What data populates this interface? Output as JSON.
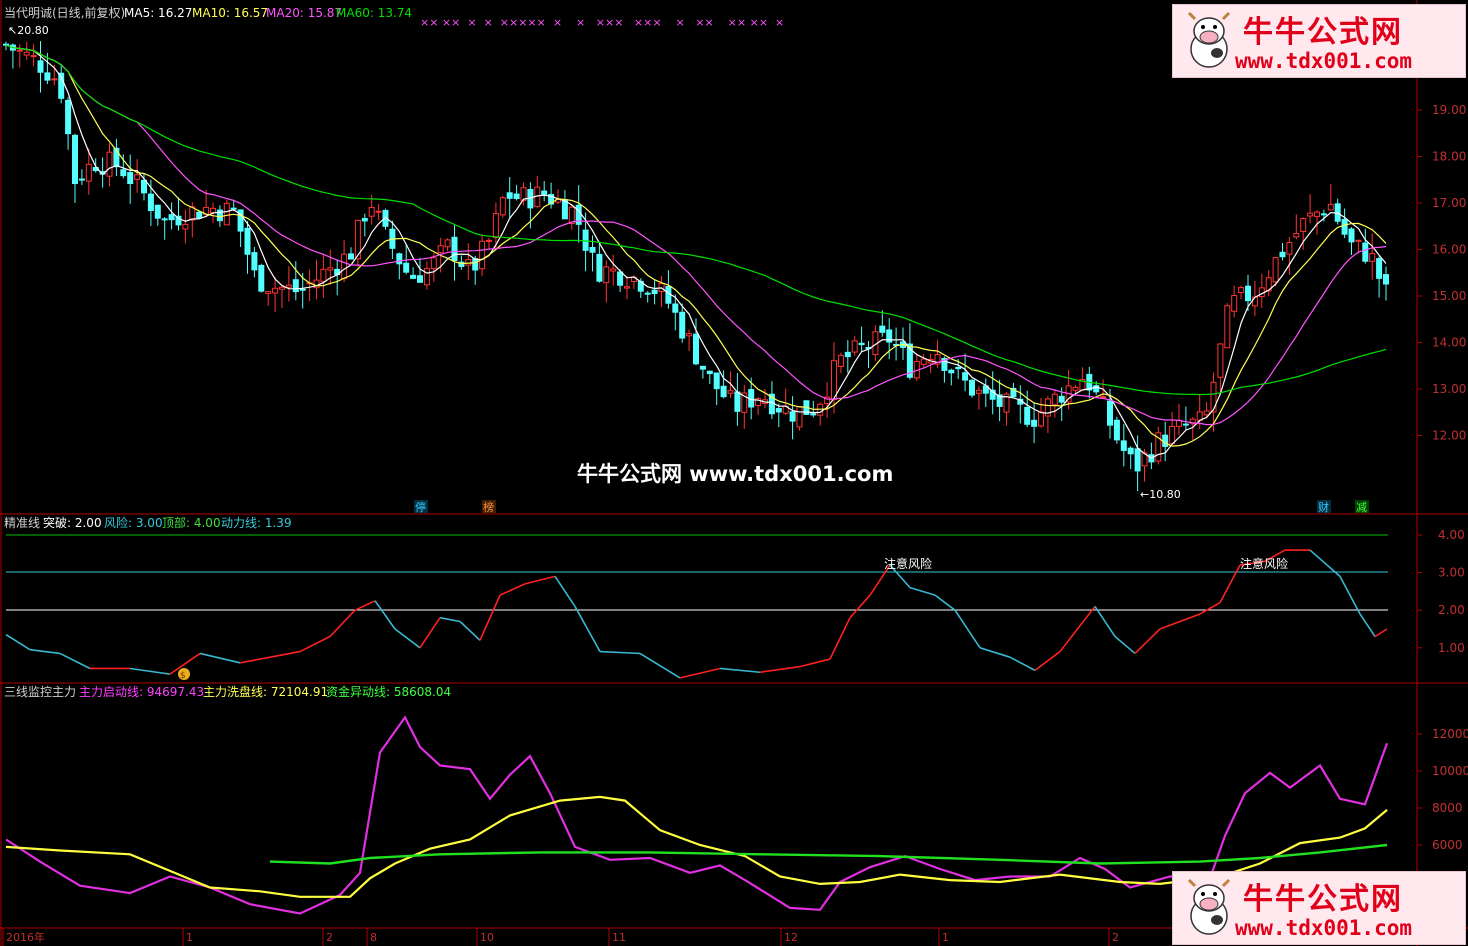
{
  "header": {
    "stock_label": "当代明诚(日线,前复权)",
    "ma5": "MA5: 16.27",
    "ma10": "MA10: 16.57",
    "ma20": "MA20: 15.87",
    "ma60": "MA60: 13.74"
  },
  "price_panel": {
    "high_label": "20.80",
    "low_label": "10.80",
    "yticks": [
      "19.00",
      "18.00",
      "17.00",
      "16.00",
      "15.00",
      "14.00",
      "13.00",
      "12.00"
    ],
    "badges": [
      {
        "text": "停",
        "color": "#38c8ff"
      },
      {
        "text": "榜",
        "color": "#ff9040"
      },
      {
        "text": "财",
        "color": "#38c8ff"
      },
      {
        "text": "减",
        "color": "#40ff40"
      }
    ],
    "cross_marks": "×× ××  ×  ×  ×××××  ×    ×   ×××   ×××    ×   ××    ×× ××  ×"
  },
  "indicator1": {
    "name": "精准线",
    "breakthrough": "突破: 2.00",
    "risk": "风险: 3.00",
    "top": "顶部: 4.00",
    "momentum": "动力线: 1.39",
    "warn1": "注意风险",
    "warn2": "注意风险",
    "yticks": [
      "4.00",
      "3.00",
      "2.00",
      "1.00"
    ]
  },
  "indicator2": {
    "name": "三线监控主力",
    "start_line": "主力启动线: 94697.43",
    "wash_line": "主力洗盘线: 72104.91",
    "fund_line": "资金异动线: 58608.04",
    "yticks": [
      "12000",
      "10000",
      "8000",
      "6000"
    ]
  },
  "xaxis": {
    "labels": [
      "2016年",
      "1",
      "2",
      "8",
      "10",
      "11",
      "12",
      "1",
      "2"
    ]
  },
  "watermark": {
    "title": "牛牛公式网",
    "url": "www.tdx001.com",
    "center": "牛牛公式网 www.tdx001.com"
  },
  "colors": {
    "up": "#ff3232",
    "down": "#54ffff",
    "ma5": "#ffffff",
    "ma10": "#ffff54",
    "ma20": "#ff54ff",
    "ma60": "#00e000",
    "axis": "#b00000"
  }
}
